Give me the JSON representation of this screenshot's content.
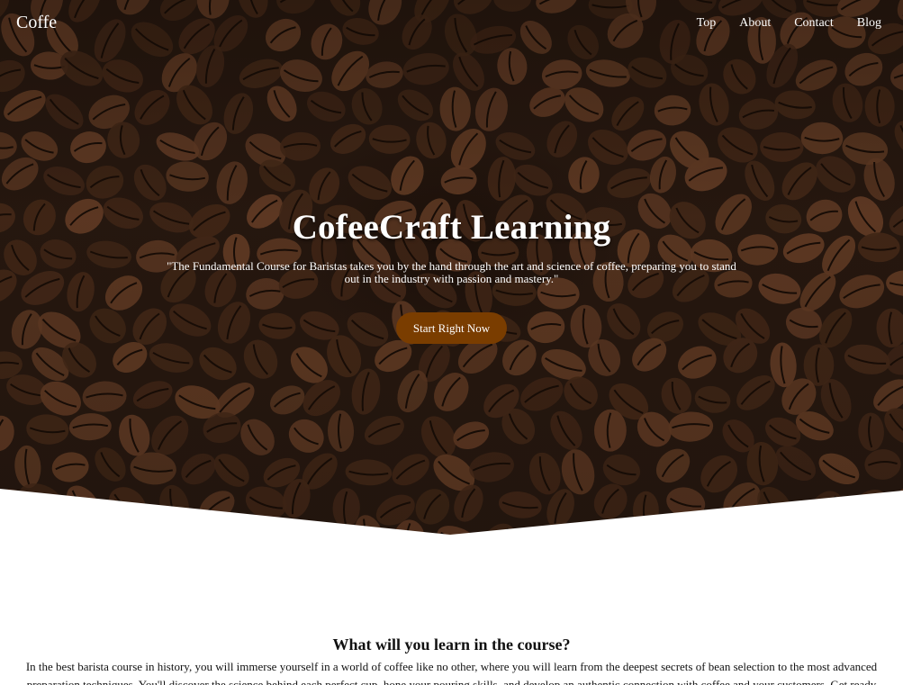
{
  "header": {
    "brand": "Coffe",
    "nav": [
      "Top",
      "About",
      "Contact",
      "Blog"
    ]
  },
  "hero": {
    "title": "CofeeCraft Learning",
    "quote": "\"The Fundamental Course for Baristas takes you by the hand through the art and science of coffee, preparing you to stand out in the industry with passion and mastery.\"",
    "cta_label": "Start Right Now",
    "background_image": "coffee-beans-photo"
  },
  "section": {
    "heading": "What will you learn in the course?",
    "paragraph": "In the best barista course in history, you will immerse yourself in a world of coffee like no other, where you will learn from the deepest secrets of bean selection to the most advanced preparation techniques. You'll discover the science behind each perfect cup, hone your pouring skills, and develop an authentic connection with coffee and your customers. Get ready to"
  },
  "colors": {
    "cta": "#7a3d00",
    "hero_dark": "#2a1a11",
    "bean": "#4a2c1a",
    "bean_highlight": "#6b4128"
  }
}
